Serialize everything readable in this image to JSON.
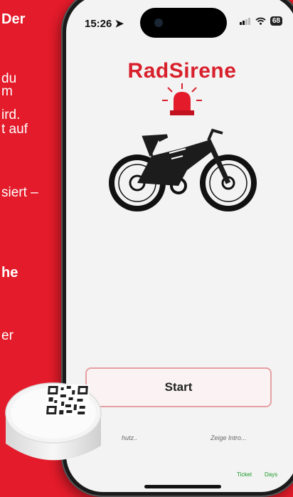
{
  "background_text": [
    {
      "id": "line1",
      "text": "Der",
      "bold": true
    },
    {
      "id": "line2",
      "text": "du",
      "bold": false
    },
    {
      "id": "line3",
      "text": "m",
      "bold": false
    },
    {
      "id": "line4",
      "text": "ird.",
      "bold": false
    },
    {
      "id": "line5",
      "text": "t auf",
      "bold": false
    },
    {
      "id": "line6",
      "text": "siert –",
      "bold": false
    },
    {
      "id": "line7",
      "text": "he",
      "bold": true
    },
    {
      "id": "line8",
      "text": "er",
      "bold": false
    }
  ],
  "status_bar": {
    "time": "15:26",
    "battery": "68"
  },
  "app": {
    "title": "RadSirene",
    "start_label": "Start",
    "link_left": "hutz..",
    "link_right": "Zeige Intro...",
    "tab_ticket": "Ticket",
    "tab_days": "Days"
  },
  "colors": {
    "brand_red": "#e31b2a",
    "title_red": "#d8202c",
    "tab_green": "#1a9a2a"
  }
}
